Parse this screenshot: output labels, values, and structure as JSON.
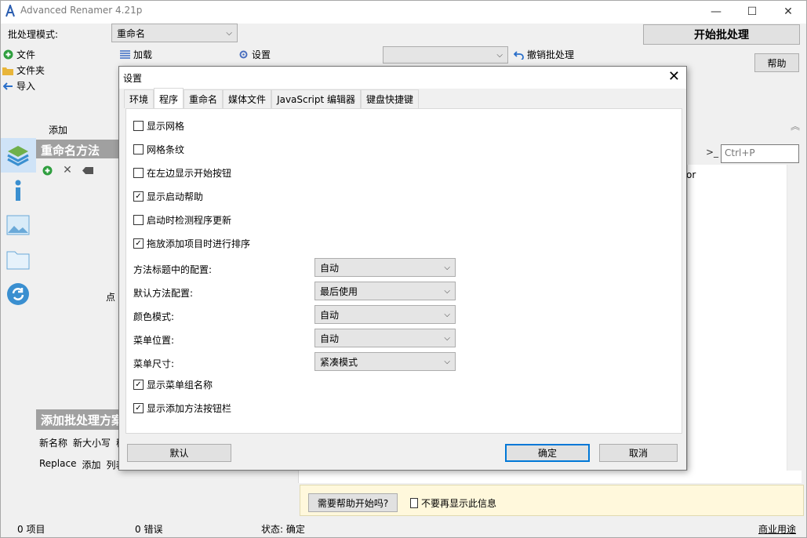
{
  "window": {
    "title": "Advanced Renamer 4.21p",
    "minimize": "—",
    "maximize": "☐",
    "close": "✕"
  },
  "toolbar": {
    "batch_mode_label": "批处理模式:",
    "batch_mode_value": "重命名",
    "start_batch": "开始批处理",
    "help": "帮助",
    "file": "文件",
    "folder": "文件夹",
    "import": "导入",
    "load": "加载",
    "settings": "设置",
    "undo_batch": "撤销批处理",
    "empty_combo": ""
  },
  "left_panel": {
    "add_label": "添加",
    "rename_methods": "重命名方法",
    "click_hint_fragment": "点",
    "add_batch_plan": "添加批处理方案",
    "method_links_row1": [
      "新名称",
      "新大小写",
      "稍"
    ],
    "method_links_row2": [
      "Replace",
      "添加",
      "列表"
    ]
  },
  "right_panel": {
    "search_placeholder": "Ctrl+P",
    "column_fragment": "or"
  },
  "help_bar": {
    "need_help_button": "需要帮助开始吗?",
    "dont_show_again": "不要再显示此信息"
  },
  "statusbar": {
    "items": "0 项目",
    "errors": "0 错误",
    "status": "状态: 确定",
    "license": "商业用途"
  },
  "dialog": {
    "title": "设置",
    "close": "✕",
    "tabs": [
      {
        "label": "环境",
        "active": false
      },
      {
        "label": "程序",
        "active": true
      },
      {
        "label": "重命名",
        "active": false
      },
      {
        "label": "媒体文件",
        "active": false
      },
      {
        "label": "JavaScript 编辑器",
        "active": false
      },
      {
        "label": "键盘快捷键",
        "active": false
      }
    ],
    "checkboxes": [
      {
        "label": "显示网格",
        "checked": false
      },
      {
        "label": "网格条纹",
        "checked": false
      },
      {
        "label": "在左边显示开始按钮",
        "checked": false
      },
      {
        "label": "显示启动帮助",
        "checked": true
      },
      {
        "label": "启动时检测程序更新",
        "checked": false
      },
      {
        "label": "拖放添加项目时进行排序",
        "checked": true
      }
    ],
    "options": [
      {
        "label": "方法标题中的配置:",
        "value": "自动"
      },
      {
        "label": "默认方法配置:",
        "value": "最后使用"
      },
      {
        "label": "颜色模式:",
        "value": "自动"
      },
      {
        "label": "菜单位置:",
        "value": "自动"
      },
      {
        "label": "菜单尺寸:",
        "value": "紧凑模式"
      }
    ],
    "checkboxes_bottom": [
      {
        "label": "显示菜单组名称",
        "checked": true
      },
      {
        "label": "显示添加方法按钮栏",
        "checked": true
      }
    ],
    "buttons": {
      "default": "默认",
      "ok": "确定",
      "cancel": "取消"
    },
    "check_mark": "✓"
  },
  "colors": {
    "accent_blue": "#0078d7",
    "band_gray": "#a0a0a0",
    "help_yellow": "#fff8dc"
  }
}
